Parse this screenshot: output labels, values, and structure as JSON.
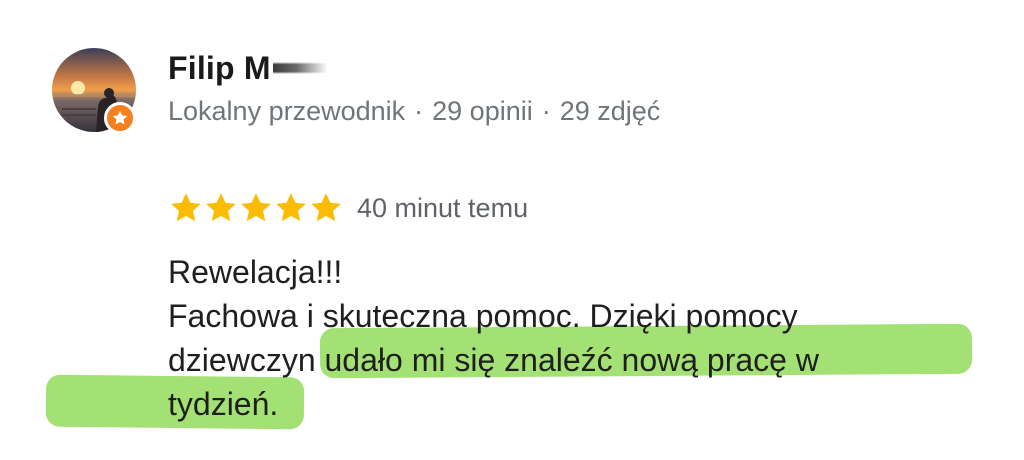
{
  "reviewer": {
    "name_visible": "Filip M",
    "meta": {
      "role": "Lokalny przewodnik",
      "reviews": "29 opinii",
      "photos": "29 zdjęć",
      "separator": "·"
    },
    "avatar_icon": "sunset-photo-avatar",
    "badge_icon": "local-guide-star-icon",
    "badge_color": "#f5801f"
  },
  "rating": {
    "stars": 5,
    "max": 5,
    "star_color": "#fbbc04",
    "time_ago": "40 minut temu"
  },
  "review_text": {
    "lines": [
      "Rewelacja!!!",
      "Fachowa i skuteczna pomoc. Dzięki pomocy",
      "dziewczyn udało mi się znaleźć nową pracę w",
      "tydzień."
    ]
  },
  "highlight": {
    "color": "#93dc5c",
    "text": "udało mi się znaleźć nową pracę w tydzień."
  }
}
